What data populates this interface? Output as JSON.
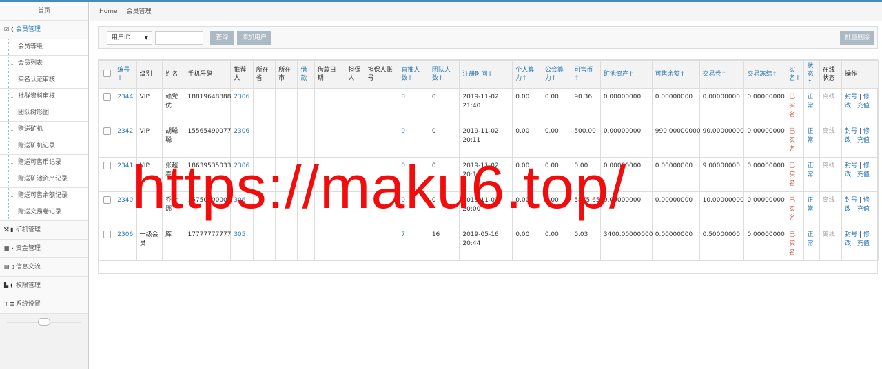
{
  "sidebar": {
    "home": "首页",
    "groups": [
      {
        "icon": "☑ (",
        "label": "会员管理",
        "active": true
      },
      {
        "icon": "⤭ ▮",
        "label": "矿机管理"
      },
      {
        "icon": "▦ ›",
        "label": "资金管理"
      },
      {
        "icon": "▤ ▯",
        "label": "信息交流"
      },
      {
        "icon": "▙ (",
        "label": "权限管理"
      },
      {
        "icon": "T ≡",
        "label": "系统设置"
      }
    ],
    "sub_items": [
      "会员等级",
      "会员列表",
      "实名认证审核",
      "社群资料审核",
      "团队树形图",
      "赠送矿机",
      "赠送矿机记录",
      "赠送可售币记录",
      "赠送矿池资产记录",
      "赠送可售余额记录",
      "赠送交易卷记录"
    ]
  },
  "breadcrumb": {
    "home": "Home",
    "current": "会员管理"
  },
  "toolbar": {
    "select_value": "用户ID",
    "search_value": "",
    "query_button": "查询",
    "add_button": "添加用户",
    "batch_delete_button": "批量删除"
  },
  "table": {
    "headers": [
      "编号↑",
      "级别",
      "姓名",
      "手机号码",
      "推荐人",
      "所在省",
      "所在市",
      "借款",
      "借款日期",
      "担保人",
      "担保人账号",
      "直推人数↑",
      "团队人数↑",
      "注册时间↑",
      "个人算力↑",
      "公会算力↑",
      "可售币↑",
      "矿池资产↑",
      "可售余额↑",
      "交易卷↑",
      "交易冻结↑",
      "实名↑",
      "状态↑",
      "在线状态",
      "操作"
    ],
    "rows": [
      [
        "2344",
        "VIP",
        "赖党优",
        "18819648888",
        "2306",
        "",
        "",
        "",
        "",
        "",
        "",
        "0",
        "0",
        "2019-11-02 21:40",
        "0.00",
        "0.00",
        "90.36",
        "0.00000000",
        "0.00000000",
        "0.00000000",
        "0.00000000",
        "已实名",
        "正常",
        "离线"
      ],
      [
        "2342",
        "VIP",
        "胡聪聪",
        "15565490077",
        "2306",
        "",
        "",
        "",
        "",
        "",
        "",
        "0",
        "0",
        "2019-11-02 20:11",
        "0.00",
        "0.00",
        "500.00",
        "0.00000000",
        "990.00000000",
        "90.00000000",
        "0.00000000",
        "已实名",
        "正常",
        "离线"
      ],
      [
        "2341",
        "VIP",
        "张超春",
        "18639535033",
        "2306",
        "",
        "",
        "",
        "",
        "",
        "",
        "0",
        "0",
        "2019-11-02 20:10",
        "0.00",
        "0.00",
        "0.00",
        "0.00000000",
        "0.00000000",
        "9.00000000",
        "0.00000000",
        "已实名",
        "正常",
        "离线"
      ],
      [
        "2340",
        "",
        "乔金娜",
        "15750000000",
        "306",
        "",
        "",
        "",
        "",
        "",
        "",
        "0",
        "0",
        "2019-11-02 20:00",
        "0.00",
        "0.00",
        "5875.65",
        "0.00000000",
        "0.00000000",
        "10.00000000",
        "0.00000000",
        "已实名",
        "正常",
        "离线"
      ],
      [
        "2306",
        "一级会员",
        "库",
        "17777777777",
        "305",
        "",
        "",
        "",
        "",
        "",
        "",
        "7",
        "16",
        "2019-05-16 20:44",
        "0.00",
        "0.00",
        "0.03",
        "3400.00000000",
        "0.00000000",
        "0.50000000",
        "0.00000000",
        "已实名",
        "正常",
        "离线"
      ]
    ],
    "action_ban": "封号",
    "action_edit": "修改",
    "action_recharge": "充值"
  },
  "watermark": "https://maku6.top/",
  "colors": {
    "accent": "#2a7ab8",
    "red": "#d15b47",
    "watermark": "#f20c0c",
    "topbar": "#438eb9"
  }
}
